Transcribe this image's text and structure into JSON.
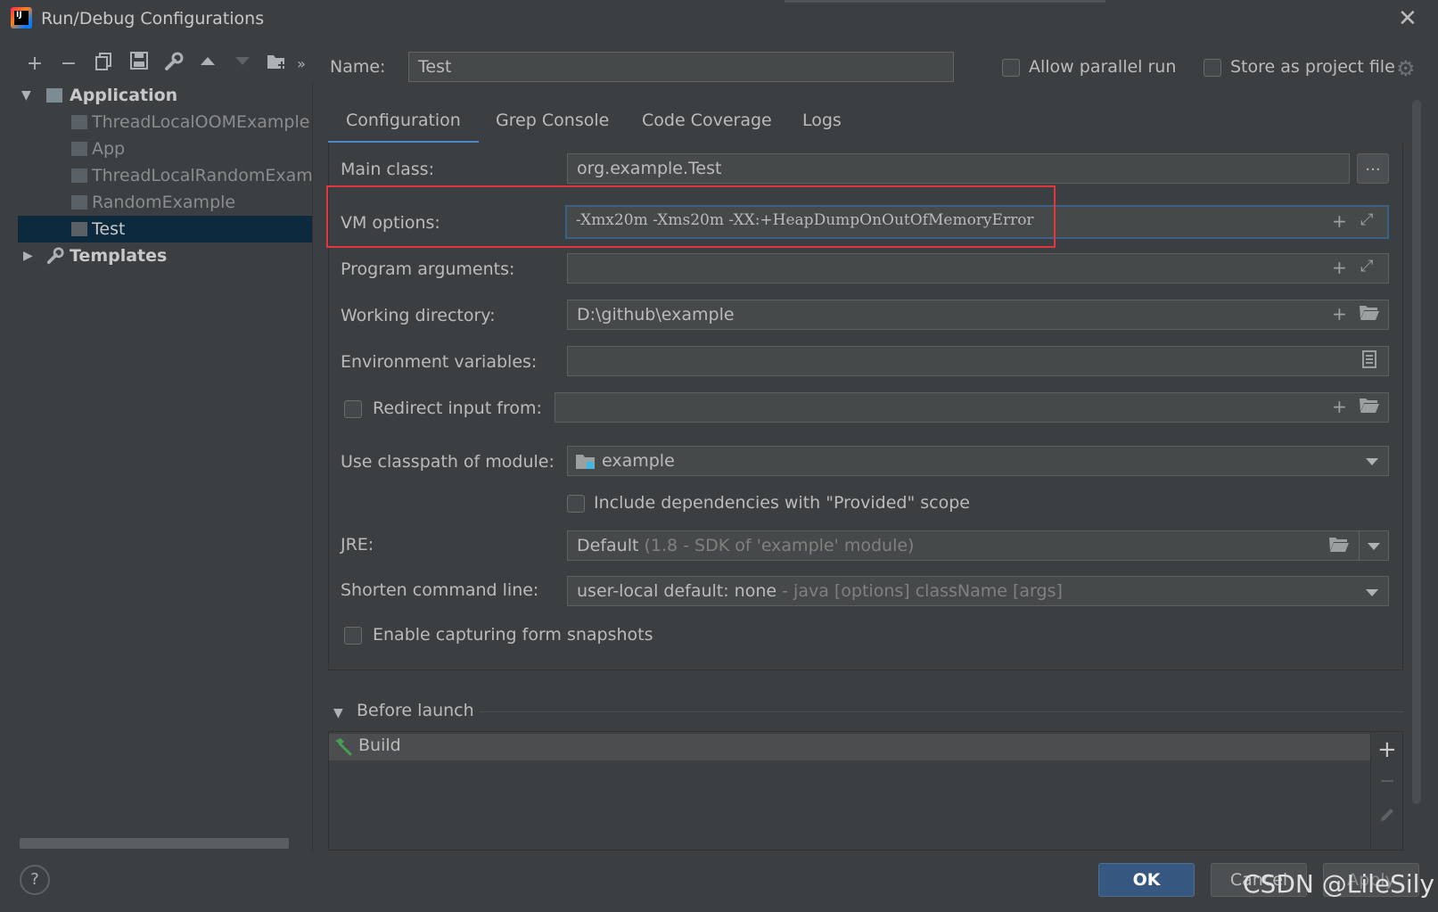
{
  "window": {
    "title": "Run/Debug Configurations"
  },
  "toolbar": {
    "more": "»"
  },
  "tree": {
    "root_label": "Application",
    "items": [
      "ThreadLocalOOMExample",
      "App",
      "ThreadLocalRandomExamp",
      "RandomExample",
      "Test"
    ],
    "selected": "Test",
    "templates_label": "Templates"
  },
  "name_row": {
    "label": "Name:",
    "value": "Test",
    "allow_parallel_label": "Allow parallel run",
    "store_project_label": "Store as project file"
  },
  "tabs": [
    "Configuration",
    "Grep Console",
    "Code Coverage",
    "Logs"
  ],
  "active_tab": "Configuration",
  "form": {
    "main_class_label": "Main class:",
    "main_class_value": "org.example.Test",
    "browse_label": "...",
    "vm_options_label": "VM options:",
    "vm_options_value": "-Xmx20m -Xms20m -XX:+HeapDumpOnOutOfMemoryError",
    "program_args_label": "Program arguments:",
    "program_args_value": "",
    "working_dir_label": "Working directory:",
    "working_dir_value": "D:\\github\\example",
    "env_vars_label": "Environment variables:",
    "env_vars_value": "",
    "redirect_label": "Redirect input from:",
    "classpath_label": "Use classpath of module:",
    "classpath_value": "example",
    "include_deps_label": "Include dependencies with \"Provided\" scope",
    "jre_label": "JRE:",
    "jre_value": "Default",
    "jre_hint": "(1.8 - SDK of 'example' module)",
    "shorten_label": "Shorten command line:",
    "shorten_value": "user-local default: none",
    "shorten_hint": "- java [options] className [args]",
    "snapshots_label": "Enable capturing form snapshots"
  },
  "before_launch": {
    "label": "Before launch",
    "items": [
      "Build"
    ]
  },
  "buttons": {
    "help": "?",
    "ok": "OK",
    "cancel": "Cancel",
    "apply": "Apply"
  },
  "watermark": "CSDN @LileSily",
  "colors": {
    "accent": "#4a88c7",
    "highlight_box": "#e2373f",
    "ok_button": "#365880",
    "selection": "#0d293e"
  }
}
